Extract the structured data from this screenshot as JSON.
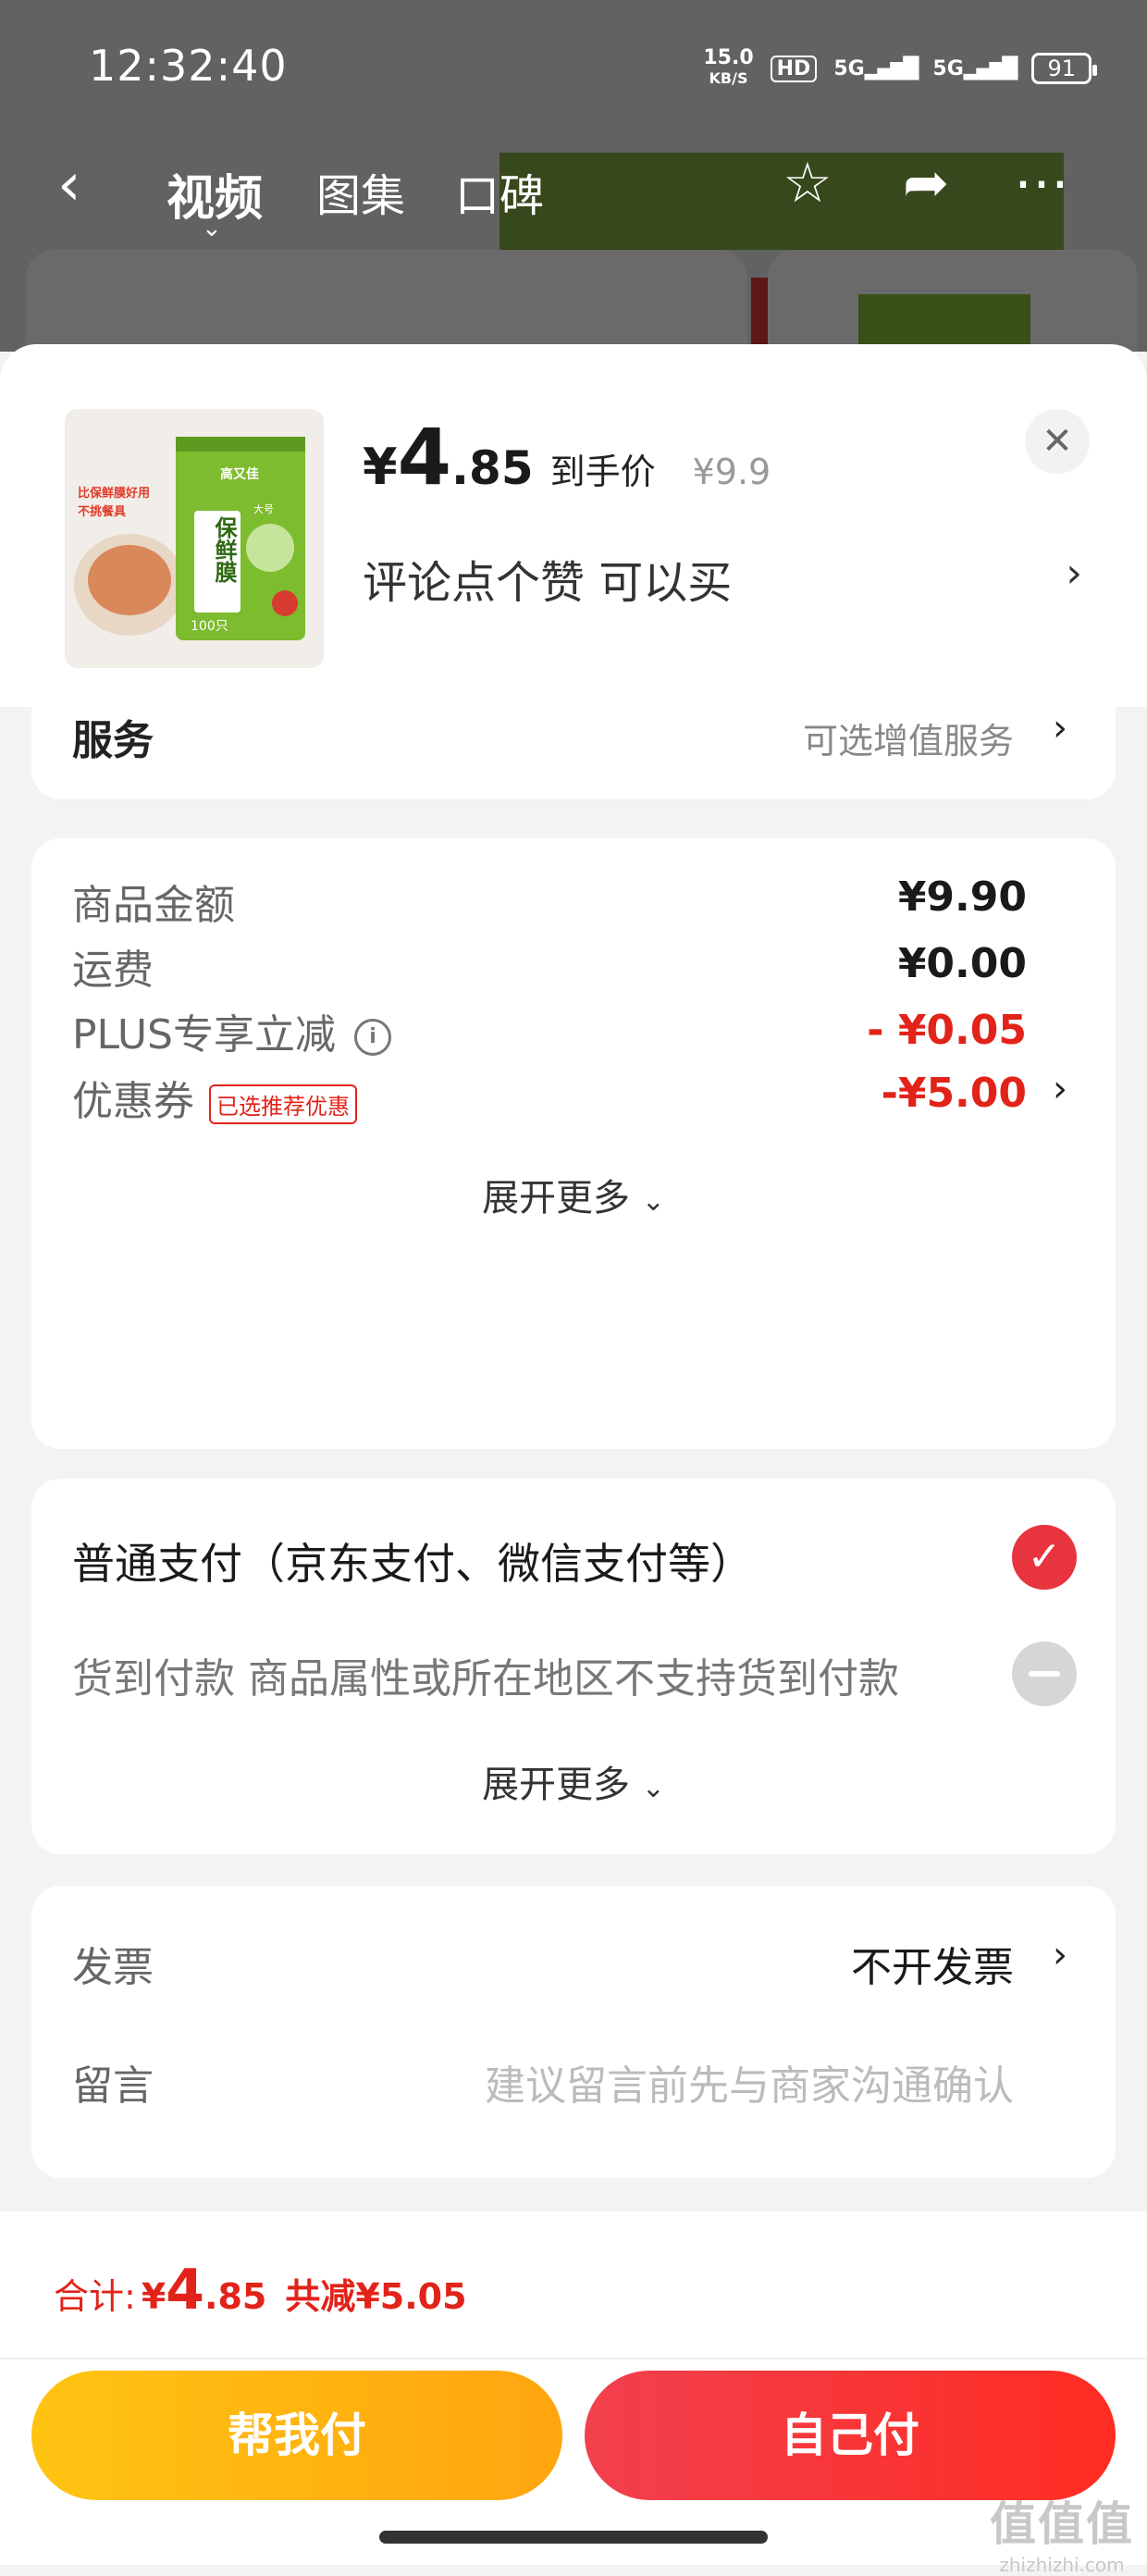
{
  "status_bar": {
    "time": "12:32:40",
    "speed_value": "15.0",
    "speed_unit": "KB/S",
    "hd": "HD",
    "signal_1": "5G",
    "signal_2": "5G",
    "battery": "91"
  },
  "nav": {
    "tabs": [
      "视频",
      "图集",
      "口碑"
    ]
  },
  "product": {
    "thumb_brand": "高又佳",
    "thumb_name": "保鲜膜",
    "thumb_count": "100只",
    "thumb_text_1": "比保鲜膜好用",
    "thumb_text_2": "不挑餐具",
    "thumb_badge": "大号",
    "price_symbol": "¥",
    "price_int": "4",
    "price_dec": ".85",
    "price_label": "到手价",
    "original_price": "¥9.9",
    "promo_text": "评论点个赞  可以买"
  },
  "service": {
    "label": "服务",
    "value": "可选增值服务"
  },
  "summary": {
    "goods_label": "商品金额",
    "goods_value": "¥9.90",
    "shipping_label": "运费",
    "shipping_value": "¥0.00",
    "plus_label": "PLUS专享立减",
    "plus_value": "- ¥0.05",
    "coupon_label": "优惠券",
    "coupon_tag": "已选推荐优惠",
    "coupon_value": "-¥5.00",
    "expand": "展开更多"
  },
  "payment": {
    "option_1": "普通支付（京东支付、微信支付等）",
    "option_2": "货到付款 商品属性或所在地区不支持货到付款",
    "expand": "展开更多"
  },
  "invoice": {
    "label": "发票",
    "value": "不开发票",
    "message_label": "留言",
    "message_placeholder": "建议留言前先与商家沟通确认"
  },
  "footer": {
    "total_label": "合计:",
    "total_symbol": "¥",
    "total_int": "4",
    "total_dec": ".85",
    "saved": "共减¥5.05",
    "help_pay": "帮我付",
    "self_pay": "自己付"
  },
  "watermark": {
    "big": "值值值",
    "small": "zhizhizhi.com"
  },
  "colors": {
    "accent_red": "#e2231a",
    "help_button": "#ffb40f",
    "self_button": "#f43a3a"
  }
}
